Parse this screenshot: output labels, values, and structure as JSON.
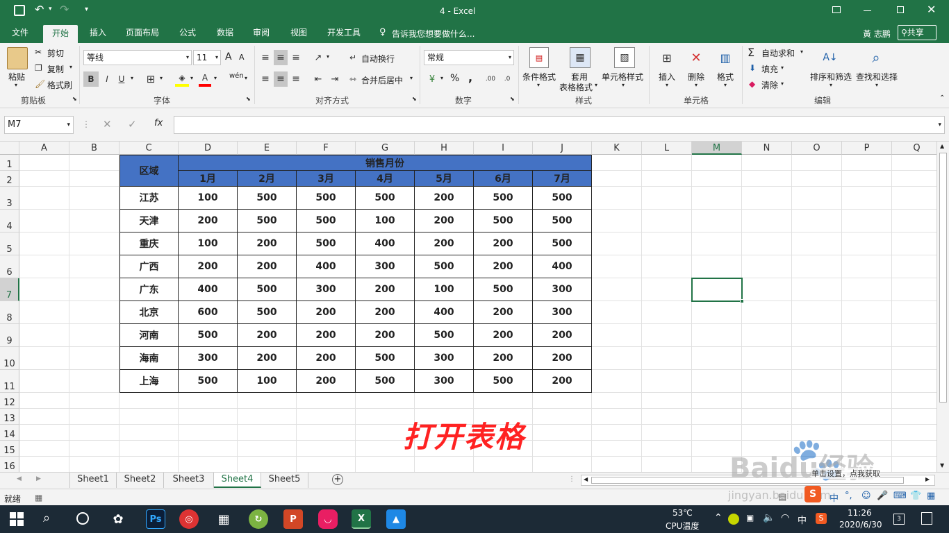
{
  "window": {
    "title": "4 - Excel"
  },
  "quick_access": {
    "save_icon": "save-icon",
    "undo_icon": "undo-icon",
    "redo_icon": "redo-icon"
  },
  "ribbon_tabs": [
    "文件",
    "开始",
    "插入",
    "页面布局",
    "公式",
    "数据",
    "审阅",
    "视图",
    "开发工具"
  ],
  "tell_me": "告诉我您想要做什么...",
  "user": {
    "name": "黃 志鹏",
    "share": "共享"
  },
  "clipboard": {
    "paste": "粘贴",
    "cut": "剪切",
    "copy": "复制",
    "format_painter": "格式刷",
    "label": "剪贴板"
  },
  "font": {
    "name": "等线",
    "size": "11",
    "grow": "A",
    "shrink": "A",
    "bold": "B",
    "italic": "I",
    "underline": "U",
    "label": "字体",
    "wen": "wén"
  },
  "alignment": {
    "wrap": "自动换行",
    "merge": "合并后居中",
    "label": "对齐方式"
  },
  "number": {
    "format": "常规",
    "percent": "%",
    "comma": ",",
    "label": "数字"
  },
  "styles": {
    "conditional": "条件格式",
    "table_a": "套用",
    "table_b": "表格格式",
    "cell_styles": "单元格样式",
    "label": "样式"
  },
  "cells": {
    "insert": "插入",
    "delete": "删除",
    "format": "格式",
    "label": "单元格"
  },
  "editing": {
    "autosum": "自动求和",
    "fill": "填充",
    "clear": "清除",
    "sort": "排序和筛选",
    "find": "查找和选择",
    "label": "编辑"
  },
  "formula_bar": {
    "name_box": "M7",
    "fx": "fx",
    "content": ""
  },
  "columns": [
    "A",
    "B",
    "C",
    "D",
    "E",
    "F",
    "G",
    "H",
    "I",
    "J",
    "K",
    "L",
    "M",
    "N",
    "O",
    "P",
    "Q"
  ],
  "rows": [
    "1",
    "2",
    "3",
    "4",
    "5",
    "6",
    "7",
    "8",
    "9",
    "10",
    "11",
    "12",
    "13",
    "14",
    "15",
    "16"
  ],
  "table": {
    "region_header": "区域",
    "sales_header": "销售月份",
    "months": [
      "1月",
      "2月",
      "3月",
      "4月",
      "5月",
      "6月",
      "7月"
    ],
    "rows": [
      {
        "region": "江苏",
        "values": [
          "100",
          "500",
          "500",
          "500",
          "200",
          "500",
          "500"
        ]
      },
      {
        "region": "天津",
        "values": [
          "200",
          "500",
          "500",
          "100",
          "200",
          "500",
          "500"
        ]
      },
      {
        "region": "重庆",
        "values": [
          "100",
          "200",
          "500",
          "400",
          "200",
          "200",
          "500"
        ]
      },
      {
        "region": "广西",
        "values": [
          "200",
          "200",
          "400",
          "300",
          "500",
          "200",
          "400"
        ]
      },
      {
        "region": "广东",
        "values": [
          "400",
          "500",
          "300",
          "200",
          "100",
          "500",
          "300"
        ]
      },
      {
        "region": "北京",
        "values": [
          "600",
          "500",
          "200",
          "200",
          "400",
          "200",
          "300"
        ]
      },
      {
        "region": "河南",
        "values": [
          "500",
          "200",
          "200",
          "200",
          "500",
          "200",
          "200"
        ]
      },
      {
        "region": "海南",
        "values": [
          "300",
          "200",
          "200",
          "500",
          "300",
          "200",
          "200"
        ]
      },
      {
        "region": "上海",
        "values": [
          "500",
          "100",
          "200",
          "500",
          "300",
          "500",
          "200"
        ]
      }
    ]
  },
  "annotation": "打开表格",
  "sheets": [
    "Sheet1",
    "Sheet2",
    "Sheet3",
    "Sheet4",
    "Sheet5"
  ],
  "active_sheet": "Sheet4",
  "status": {
    "ready": "就绪"
  },
  "watermark": {
    "brand": "Baidu经验",
    "url": "jingyan.baidu.com",
    "note": "单击设置，点我获取"
  },
  "taskbar": {
    "temp": "53℃",
    "cpu": "CPU温度",
    "time": "11:26",
    "date": "2020/6/30",
    "ime": "中"
  }
}
